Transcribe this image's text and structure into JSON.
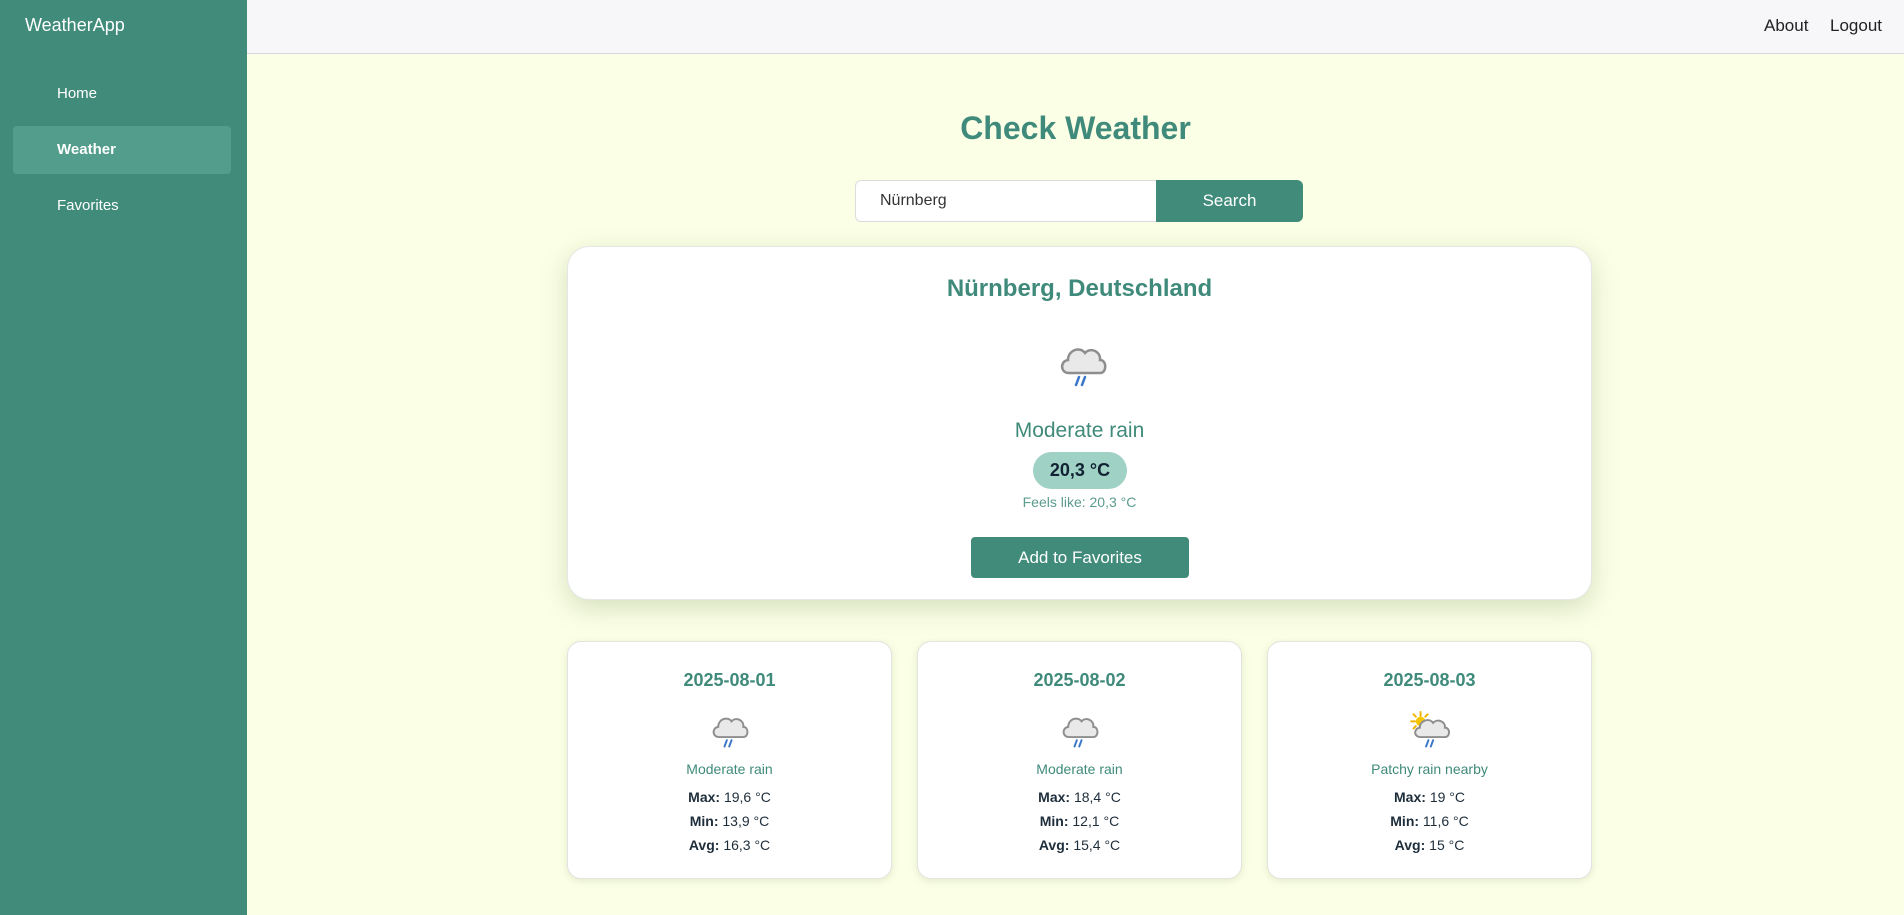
{
  "app": {
    "brand": "WeatherApp"
  },
  "sidebar": {
    "items": [
      {
        "label": "Home",
        "active": false
      },
      {
        "label": "Weather",
        "active": true
      },
      {
        "label": "Favorites",
        "active": false
      }
    ]
  },
  "topnav": {
    "about": "About",
    "logout": "Logout"
  },
  "page": {
    "title": "Check Weather"
  },
  "search": {
    "value": "Nürnberg",
    "button": "Search"
  },
  "current": {
    "location": "Nürnberg, Deutschland",
    "icon": "cloud-rain-icon",
    "condition": "Moderate rain",
    "temperature": "20,3 °C",
    "feels_like": "Feels like: 20,3 °C",
    "favorite_button": "Add to Favorites"
  },
  "forecast": [
    {
      "date": "2025-08-01",
      "icon": "cloud-rain-icon",
      "condition": "Moderate rain",
      "max_label": "Max:",
      "max": "19,6 °C",
      "min_label": "Min:",
      "min": "13,9 °C",
      "avg_label": "Avg:",
      "avg": "16,3 °C"
    },
    {
      "date": "2025-08-02",
      "icon": "cloud-rain-icon",
      "condition": "Moderate rain",
      "max_label": "Max:",
      "max": "18,4 °C",
      "min_label": "Min:",
      "min": "12,1 °C",
      "avg_label": "Avg:",
      "avg": "15,4 °C"
    },
    {
      "date": "2025-08-03",
      "icon": "sun-cloud-rain-icon",
      "condition": "Patchy rain nearby",
      "max_label": "Max:",
      "max": "19 °C",
      "min_label": "Min:",
      "min": "11,6 °C",
      "avg_label": "Avg:",
      "avg": "15 °C"
    }
  ],
  "colors": {
    "primary": "#408b7a",
    "background": "#fbffe6",
    "badge": "#9fd1c4",
    "active_nav": "#529d8b"
  }
}
